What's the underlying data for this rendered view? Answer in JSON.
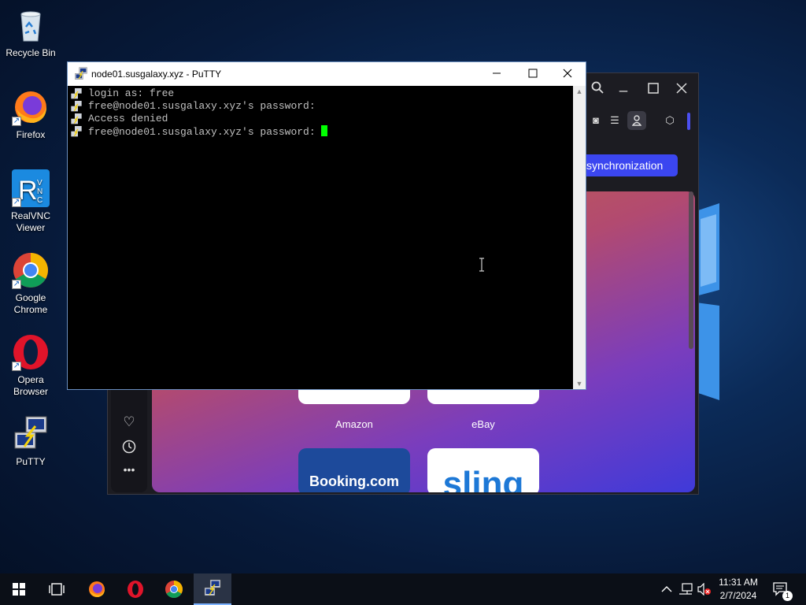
{
  "desktop": {
    "icons": [
      {
        "label": "Recycle Bin",
        "icon": "recycle-bin-icon"
      },
      {
        "label": "Firefox",
        "icon": "firefox-icon"
      },
      {
        "label": "RealVNC Viewer",
        "icon": "realvnc-icon"
      },
      {
        "label": "Google Chrome",
        "icon": "chrome-icon"
      },
      {
        "label": "Opera Browser",
        "icon": "opera-icon"
      },
      {
        "label": "PuTTY",
        "icon": "putty-icon"
      }
    ]
  },
  "opera": {
    "sync_button": "synchronization",
    "speed_dial": [
      {
        "label": "Amazon"
      },
      {
        "label": "eBay"
      },
      {
        "label": "Booking.com"
      },
      {
        "label": "sling"
      }
    ]
  },
  "putty": {
    "title": "node01.susgalaxy.xyz - PuTTY",
    "lines": [
      "login as: free",
      "free@node01.susgalaxy.xyz's password:",
      "Access denied",
      "free@node01.susgalaxy.xyz's password: "
    ]
  },
  "taskbar": {
    "time": "11:31 AM",
    "date": "2/7/2024",
    "notification_count": "1",
    "items": [
      "start-button",
      "task-view-button",
      "firefox-taskbar",
      "opera-taskbar",
      "chrome-taskbar",
      "putty-taskbar"
    ]
  },
  "colors": {
    "accent": "#3b46f0",
    "terminal_bg": "#000000",
    "terminal_cursor": "#00ff00"
  }
}
